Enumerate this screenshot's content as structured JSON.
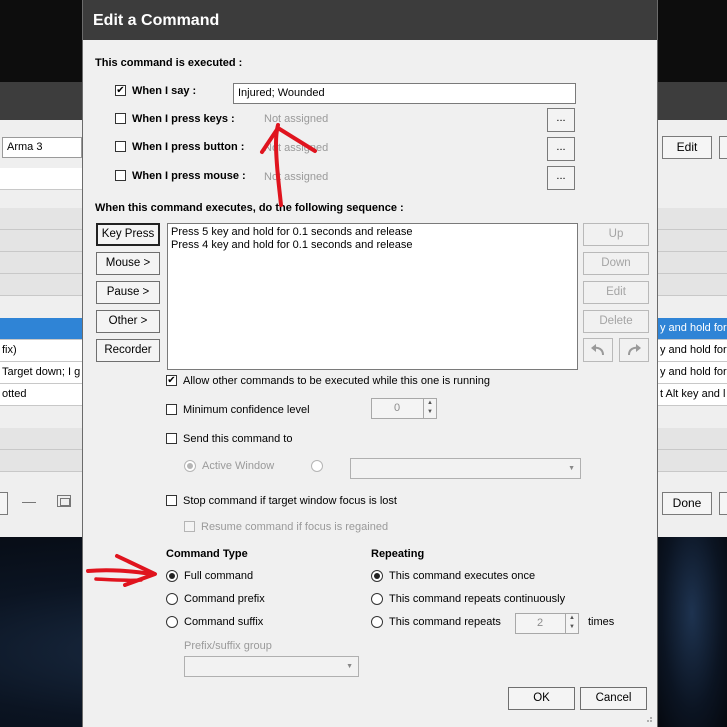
{
  "dialog": {
    "title": "Edit a Command",
    "executed_heading": "This command is executed :",
    "when_say": {
      "label": "When I say :",
      "checked": true,
      "value": "Injured; Wounded"
    },
    "when_keys": {
      "label": "When I press keys :",
      "value": "Not assigned",
      "button": "..."
    },
    "when_button": {
      "label": "When I press button :",
      "value": "Not assigned",
      "button": "..."
    },
    "when_mouse": {
      "label": "When I press mouse :",
      "value": "Not assigned",
      "button": "..."
    },
    "sequence_heading": "When this command executes, do the following sequence :",
    "left_buttons": [
      "Key Press",
      "Mouse >",
      "Pause >",
      "Other >",
      "Recorder"
    ],
    "sequence_items": [
      "Press 5 key and hold for 0.1 seconds and release",
      "Press 4 key and hold for 0.1 seconds and release"
    ],
    "right_buttons": [
      "Up",
      "Down",
      "Edit",
      "Delete"
    ],
    "undo_icon": "undo-icon",
    "redo_icon": "redo-icon",
    "allow_other": {
      "label": "Allow other commands to be executed while this one is running",
      "checked": true
    },
    "min_confidence": {
      "label": "Minimum confidence level",
      "value": "0"
    },
    "send_to": {
      "label": "Send this command to",
      "active_window": "Active Window"
    },
    "stop_focus": {
      "label": "Stop command if target window focus is lost"
    },
    "resume_focus": {
      "label": "Resume command if focus is regained"
    },
    "command_type": {
      "heading": "Command Type",
      "options": [
        "Full command",
        "Command prefix",
        "Command suffix"
      ],
      "selected": "Full command",
      "group_label": "Prefix/suffix group"
    },
    "repeating": {
      "heading": "Repeating",
      "options": [
        "This command executes once",
        "This command repeats continuously",
        "This command repeats"
      ],
      "selected": "This command executes once",
      "repeat_count": "2",
      "times_label": "times"
    },
    "ok": "OK",
    "cancel": "Cancel"
  },
  "background": {
    "profile": "Arma 3",
    "edit_button": "Edit",
    "done_button": "Done",
    "rows_left": [
      "fix)",
      "Target down; I g",
      "otted"
    ],
    "rows_right": [
      "y and hold for",
      "y and hold for",
      "y and hold for",
      "t Alt key and l"
    ]
  },
  "annotation_color": "#e0141e"
}
